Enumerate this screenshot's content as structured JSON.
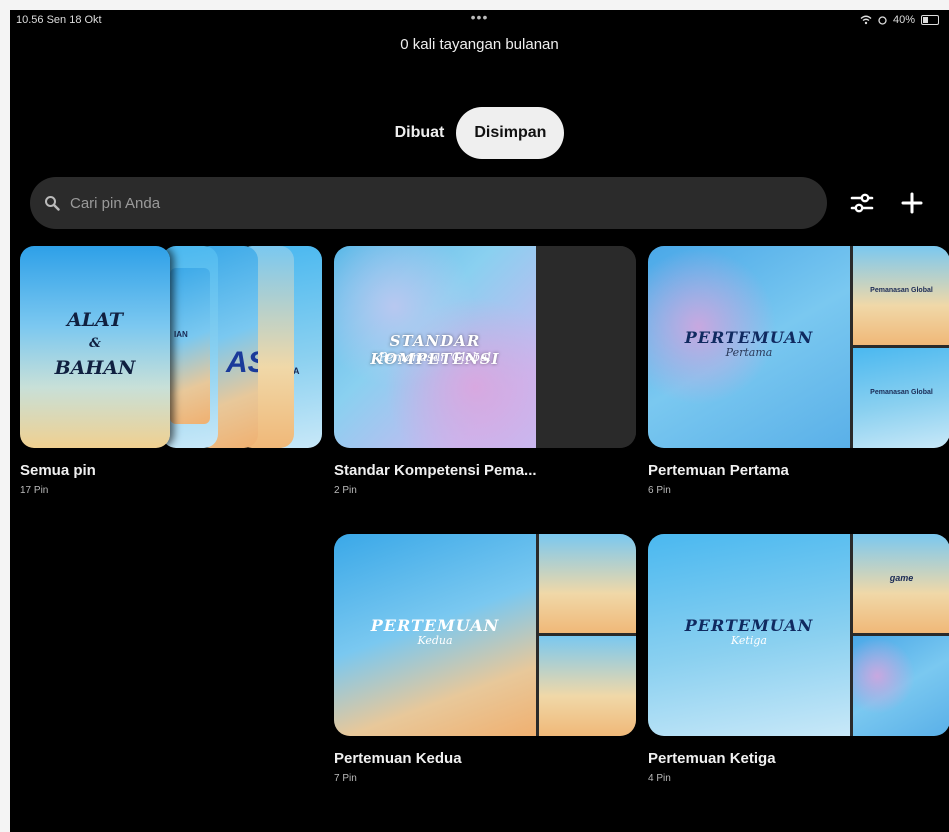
{
  "status_bar": {
    "time": "10.56  Sen 18 Okt",
    "dots": "•••",
    "battery_text": "40%"
  },
  "header": {
    "views": "0 kali tayangan bulanan"
  },
  "tabs": [
    {
      "label": "Dibuat",
      "active": false
    },
    {
      "label": "Disimpan",
      "active": true
    }
  ],
  "search": {
    "placeholder": "Cari pin Anda"
  },
  "toolbar": {
    "filter_icon": "sliders-icon",
    "add_icon": "plus-icon"
  },
  "all_pins": {
    "name": "Semua pin",
    "count": "17 Pin",
    "cover_lines": [
      "ALAT",
      "&",
      "BAHAN"
    ],
    "stack_labels": [
      "IAN",
      "ASI",
      "LOBA"
    ]
  },
  "boards": [
    {
      "name": "Standar Kompetensi Pema...",
      "count": "2 Pin",
      "cover_title": "STANDAR KOMPETENSI",
      "cover_sub": "Pemanasan Global"
    },
    {
      "name": "Pertemuan Pertama",
      "count": "6 Pin",
      "cover_title": "PERTEMUAN",
      "cover_sub": "Pertama",
      "side1_text": "Pemanasan Global",
      "side2_text": "Pemanasan Global"
    },
    {
      "name": "Pertemuan Kedua",
      "count": "7 Pin",
      "cover_title": "PERTEMUAN",
      "cover_sub": "Kedua"
    },
    {
      "name": "Pertemuan Ketiga",
      "count": "4 Pin",
      "cover_title": "PERTEMUAN",
      "cover_sub": "Ketiga",
      "side1_text": "game"
    }
  ],
  "colors": {
    "background": "#000000",
    "search_bg": "#2b2b2b",
    "active_tab_bg": "#efefef"
  }
}
